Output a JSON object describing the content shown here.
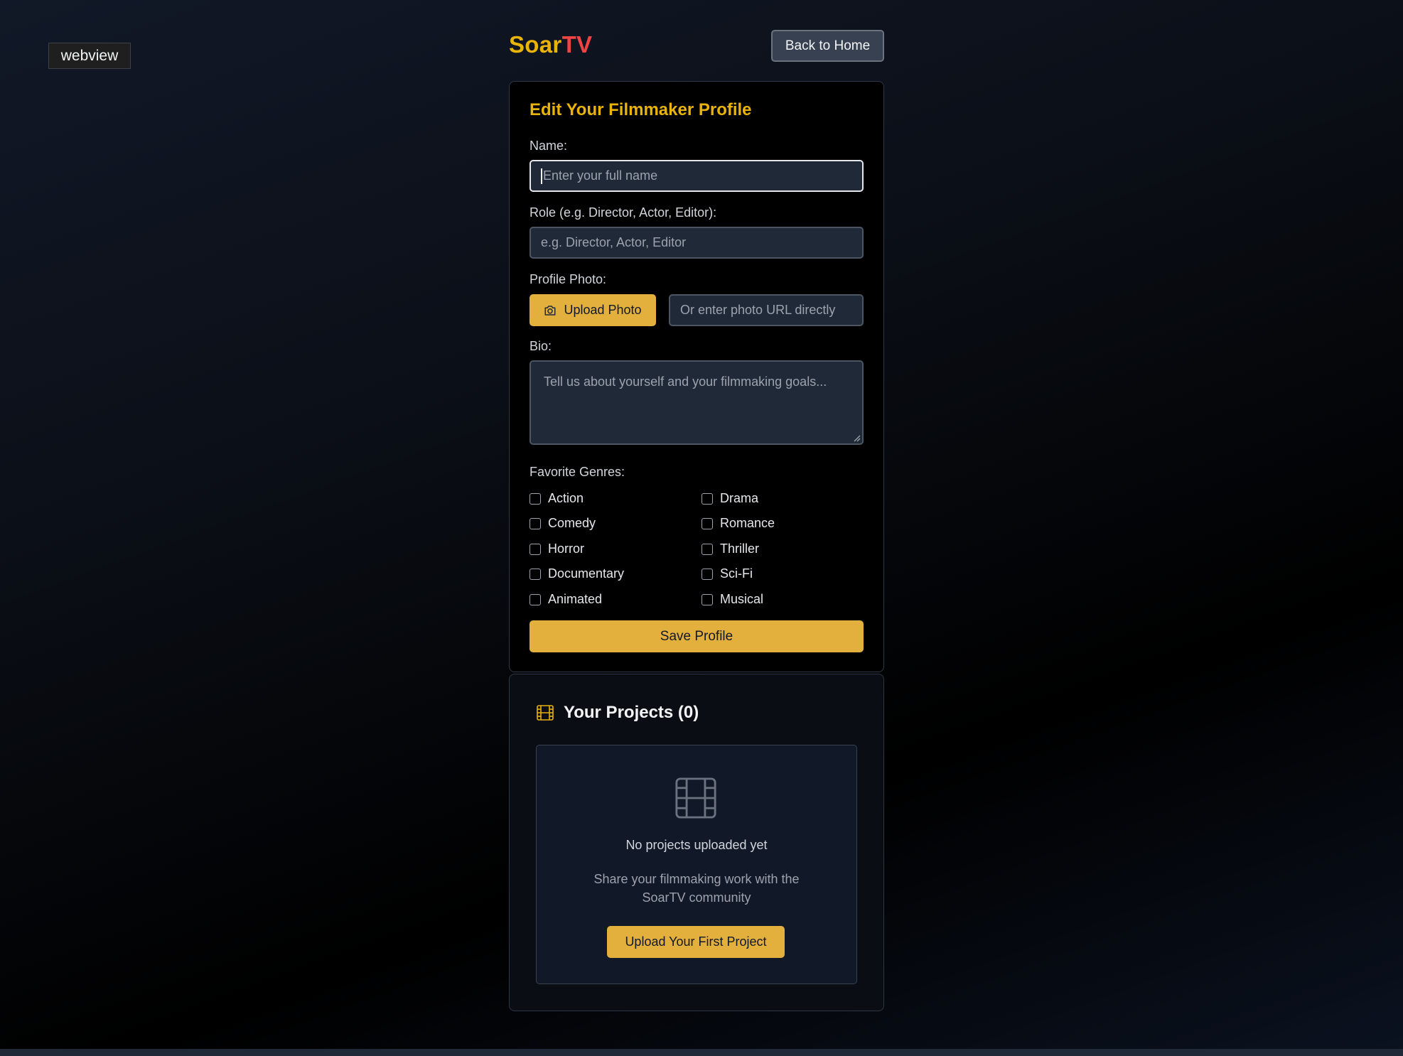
{
  "webview_tag": "webview",
  "header": {
    "logo_part1": "Soar",
    "logo_part2": "TV",
    "back_button": "Back to Home"
  },
  "profile_form": {
    "title": "Edit Your Filmmaker Profile",
    "name_label": "Name:",
    "name_placeholder": "Enter your full name",
    "role_label": "Role (e.g. Director, Actor, Editor):",
    "role_placeholder": "e.g. Director, Actor, Editor",
    "photo_label": "Profile Photo:",
    "upload_button": "Upload Photo",
    "photo_url_placeholder": "Or enter photo URL directly",
    "bio_label": "Bio:",
    "bio_placeholder": "Tell us about yourself and your filmmaking goals...",
    "genres_label": "Favorite Genres:",
    "genres": [
      "Action",
      "Drama",
      "Comedy",
      "Romance",
      "Horror",
      "Thriller",
      "Documentary",
      "Sci-Fi",
      "Animated",
      "Musical"
    ],
    "save_button": "Save Profile"
  },
  "projects": {
    "title": "Your Projects (0)",
    "empty_title": "No projects uploaded yet",
    "empty_subtitle": "Share your filmmaking work with the SoarTV community",
    "upload_first_button": "Upload Your First Project"
  },
  "colors": {
    "accent": "#e3b03e",
    "logo_soar": "#eab308",
    "logo_tv": "#ef4444"
  }
}
